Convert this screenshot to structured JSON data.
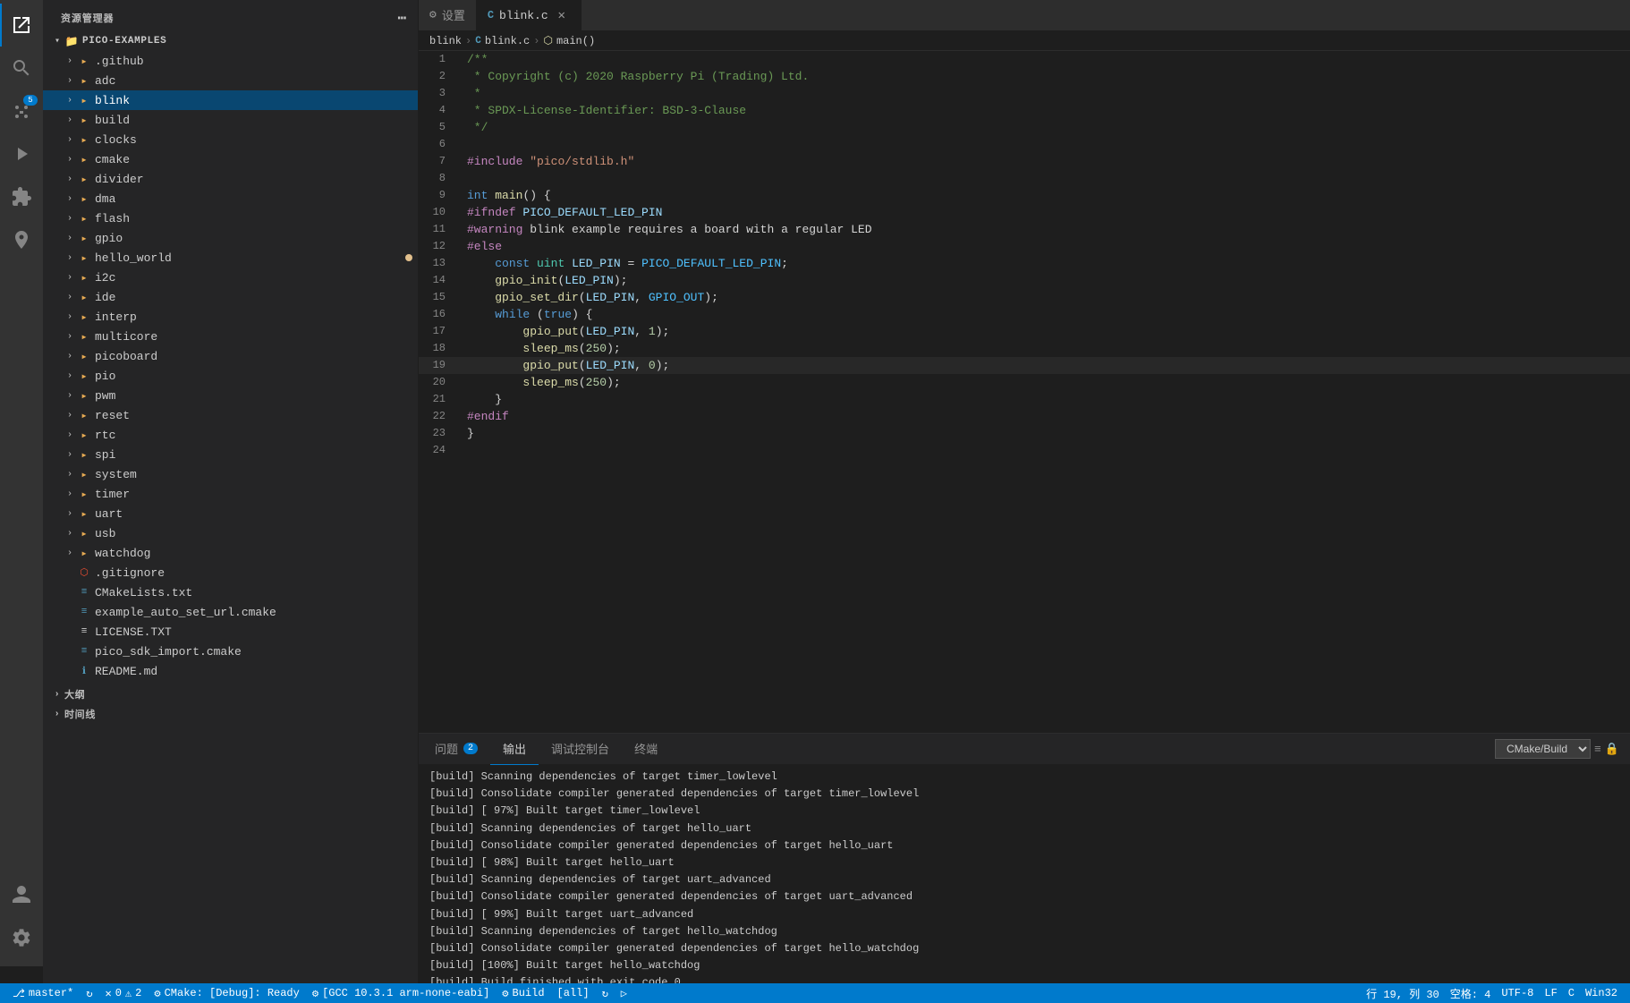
{
  "sidebar": {
    "title": "资源管理器",
    "root": "PICO-EXAMPLES",
    "items": [
      {
        "id": "github",
        "label": ".github",
        "type": "folder",
        "indent": 2,
        "collapsed": true
      },
      {
        "id": "adc",
        "label": "adc",
        "type": "folder",
        "indent": 2,
        "collapsed": true
      },
      {
        "id": "blink",
        "label": "blink",
        "type": "folder",
        "indent": 2,
        "collapsed": true,
        "selected": true
      },
      {
        "id": "build",
        "label": "build",
        "type": "folder",
        "indent": 2,
        "collapsed": true
      },
      {
        "id": "clocks",
        "label": "clocks",
        "type": "folder",
        "indent": 2,
        "collapsed": true
      },
      {
        "id": "cmake",
        "label": "cmake",
        "type": "folder",
        "indent": 2,
        "collapsed": true
      },
      {
        "id": "divider",
        "label": "divider",
        "type": "folder",
        "indent": 2,
        "collapsed": true
      },
      {
        "id": "dma",
        "label": "dma",
        "type": "folder",
        "indent": 2,
        "collapsed": true
      },
      {
        "id": "flash",
        "label": "flash",
        "type": "folder",
        "indent": 2,
        "collapsed": true
      },
      {
        "id": "gpio",
        "label": "gpio",
        "type": "folder",
        "indent": 2,
        "collapsed": true
      },
      {
        "id": "hello_world",
        "label": "hello_world",
        "type": "folder",
        "indent": 2,
        "collapsed": true,
        "modified": true
      },
      {
        "id": "i2c",
        "label": "i2c",
        "type": "folder",
        "indent": 2,
        "collapsed": true
      },
      {
        "id": "ide",
        "label": "ide",
        "type": "folder",
        "indent": 2,
        "collapsed": true
      },
      {
        "id": "interp",
        "label": "interp",
        "type": "folder",
        "indent": 2,
        "collapsed": true
      },
      {
        "id": "multicore",
        "label": "multicore",
        "type": "folder",
        "indent": 2,
        "collapsed": true
      },
      {
        "id": "picoboard",
        "label": "picoboard",
        "type": "folder",
        "indent": 2,
        "collapsed": true
      },
      {
        "id": "pio",
        "label": "pio",
        "type": "folder",
        "indent": 2,
        "collapsed": true
      },
      {
        "id": "pwm",
        "label": "pwm",
        "type": "folder",
        "indent": 2,
        "collapsed": true
      },
      {
        "id": "reset",
        "label": "reset",
        "type": "folder",
        "indent": 2,
        "collapsed": true
      },
      {
        "id": "rtc",
        "label": "rtc",
        "type": "folder",
        "indent": 2,
        "collapsed": true
      },
      {
        "id": "spi",
        "label": "spi",
        "type": "folder",
        "indent": 2,
        "collapsed": true
      },
      {
        "id": "system",
        "label": "system",
        "type": "folder",
        "indent": 2,
        "collapsed": true
      },
      {
        "id": "timer",
        "label": "timer",
        "type": "folder",
        "indent": 2,
        "collapsed": true
      },
      {
        "id": "uart",
        "label": "uart",
        "type": "folder",
        "indent": 2,
        "collapsed": true
      },
      {
        "id": "usb",
        "label": "usb",
        "type": "folder",
        "indent": 2,
        "collapsed": true
      },
      {
        "id": "watchdog",
        "label": "watchdog",
        "type": "folder",
        "indent": 2,
        "collapsed": true
      },
      {
        "id": "gitignore",
        "label": ".gitignore",
        "type": "git",
        "indent": 2
      },
      {
        "id": "CMakeLists",
        "label": "CMakeLists.txt",
        "type": "cmake",
        "indent": 2
      },
      {
        "id": "example_auto",
        "label": "example_auto_set_url.cmake",
        "type": "cmake",
        "indent": 2
      },
      {
        "id": "LICENSE",
        "label": "LICENSE.TXT",
        "type": "txt",
        "indent": 2
      },
      {
        "id": "pico_sdk_import",
        "label": "pico_sdk_import.cmake",
        "type": "cmake",
        "indent": 2
      },
      {
        "id": "README",
        "label": "README.md",
        "type": "md",
        "indent": 2
      }
    ],
    "outline_label": "大纲",
    "timeline_label": "时间线"
  },
  "tabs": [
    {
      "id": "settings",
      "label": "设置",
      "active": false,
      "modified": false,
      "icon": "gear"
    },
    {
      "id": "blink_c",
      "label": "blink.c",
      "active": true,
      "modified": false,
      "icon": "c"
    }
  ],
  "breadcrumb": {
    "items": [
      "blink",
      "blink.c",
      "main()"
    ]
  },
  "code": {
    "filename": "blink.c",
    "lines": [
      {
        "num": 1,
        "text": "/**"
      },
      {
        "num": 2,
        "text": " * Copyright (c) 2020 Raspberry Pi (Trading) Ltd."
      },
      {
        "num": 3,
        "text": " *"
      },
      {
        "num": 4,
        "text": " * SPDX-License-Identifier: BSD-3-Clause"
      },
      {
        "num": 5,
        "text": " */"
      },
      {
        "num": 6,
        "text": ""
      },
      {
        "num": 7,
        "text": "#include \"pico/stdlib.h\""
      },
      {
        "num": 8,
        "text": ""
      },
      {
        "num": 9,
        "text": "int main() {"
      },
      {
        "num": 10,
        "text": "#ifndef PICO_DEFAULT_LED_PIN"
      },
      {
        "num": 11,
        "text": "#warning blink example requires a board with a regular LED"
      },
      {
        "num": 12,
        "text": "#else"
      },
      {
        "num": 13,
        "text": "    const uint LED_PIN = PICO_DEFAULT_LED_PIN;"
      },
      {
        "num": 14,
        "text": "    gpio_init(LED_PIN);"
      },
      {
        "num": 15,
        "text": "    gpio_set_dir(LED_PIN, GPIO_OUT);"
      },
      {
        "num": 16,
        "text": "    while (true) {"
      },
      {
        "num": 17,
        "text": "        gpio_put(LED_PIN, 1);"
      },
      {
        "num": 18,
        "text": "        sleep_ms(250);"
      },
      {
        "num": 19,
        "text": "        gpio_put(LED_PIN, 0);"
      },
      {
        "num": 20,
        "text": "        sleep_ms(250);"
      },
      {
        "num": 21,
        "text": "    }"
      },
      {
        "num": 22,
        "text": "#endif"
      },
      {
        "num": 23,
        "text": "}"
      },
      {
        "num": 24,
        "text": ""
      }
    ]
  },
  "panel": {
    "tabs": [
      {
        "id": "problems",
        "label": "问题",
        "badge": 2
      },
      {
        "id": "output",
        "label": "输出",
        "active": true
      },
      {
        "id": "debug_console",
        "label": "调试控制台"
      },
      {
        "id": "terminal",
        "label": "终端"
      }
    ],
    "build_selector": "CMake/Build",
    "output_lines": [
      "[build] Scanning dependencies of target timer_lowlevel",
      "[build] Consolidate compiler generated dependencies of target timer_lowlevel",
      "[build] [ 97%] Built target timer_lowlevel",
      "[build] Scanning dependencies of target hello_uart",
      "[build] Consolidate compiler generated dependencies of target hello_uart",
      "[build] [ 98%] Built target hello_uart",
      "[build] Scanning dependencies of target uart_advanced",
      "[build] Consolidate compiler generated dependencies of target uart_advanced",
      "[build] [ 99%] Built target uart_advanced",
      "[build] Scanning dependencies of target hello_watchdog",
      "[build] Consolidate compiler generated dependencies of target hello_watchdog",
      "[build] [100%] Built target hello_watchdog",
      "[build] Build finished with exit code 0"
    ]
  },
  "statusbar": {
    "branch": "master*",
    "sync_icon": "↻",
    "errors": "0",
    "warnings": "2",
    "cmake_label": "CMake: [Debug]: Ready",
    "gcc_label": "[GCC 10.3.1 arm-none-eabi]",
    "build_label": "Build",
    "line": "行 19, 列 30",
    "spaces": "空格: 4",
    "encoding": "UTF-8",
    "line_ending": "LF",
    "lang": "C",
    "os": "Win32"
  }
}
